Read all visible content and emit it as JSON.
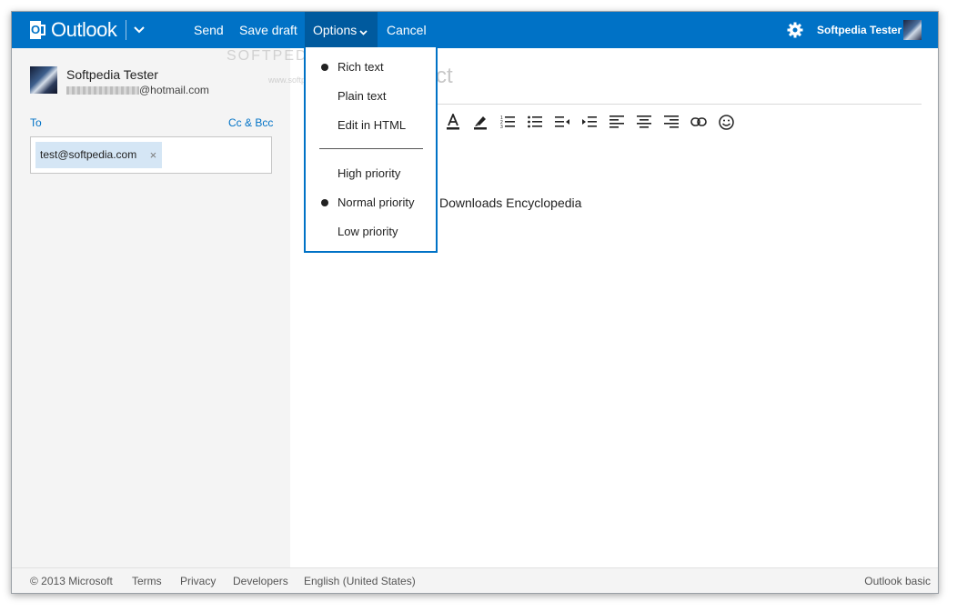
{
  "app": {
    "name": "Outlook"
  },
  "toolbar": {
    "send_label": "Send",
    "save_draft_label": "Save draft",
    "options_label": "Options",
    "cancel_label": "Cancel",
    "user_name": "Softpedia Tester",
    "accent_color": "#0072c6"
  },
  "sender": {
    "name": "Softpedia Tester",
    "email_suffix": "@hotmail.com"
  },
  "recipients": {
    "to_label": "To",
    "cc_bcc_label": "Cc & Bcc",
    "to": [
      {
        "address": "test@softpedia.com",
        "remove_glyph": "×"
      }
    ]
  },
  "compose": {
    "subject_placeholder": "ct",
    "body_text": "Downloads Encyclopedia",
    "format_icons": [
      "font-color-icon",
      "highlight-icon",
      "numbered-list-icon",
      "bullet-list-icon",
      "decrease-indent-icon",
      "increase-indent-icon",
      "align-left-icon",
      "align-center-icon",
      "align-right-icon",
      "link-icon",
      "emoticon-icon"
    ]
  },
  "options_menu": {
    "format": [
      {
        "label": "Rich text",
        "selected": true
      },
      {
        "label": "Plain text",
        "selected": false
      },
      {
        "label": "Edit in HTML",
        "selected": false
      }
    ],
    "priority": [
      {
        "label": "High priority",
        "selected": false
      },
      {
        "label": "Normal priority",
        "selected": true
      },
      {
        "label": "Low priority",
        "selected": false
      }
    ]
  },
  "watermark": {
    "text": "SOFTPEDIA",
    "url": "www.softpedia.com"
  },
  "footer": {
    "copyright": "© 2013 Microsoft",
    "terms": "Terms",
    "privacy": "Privacy",
    "developers": "Developers",
    "language": "English (United States)",
    "basic": "Outlook basic"
  }
}
